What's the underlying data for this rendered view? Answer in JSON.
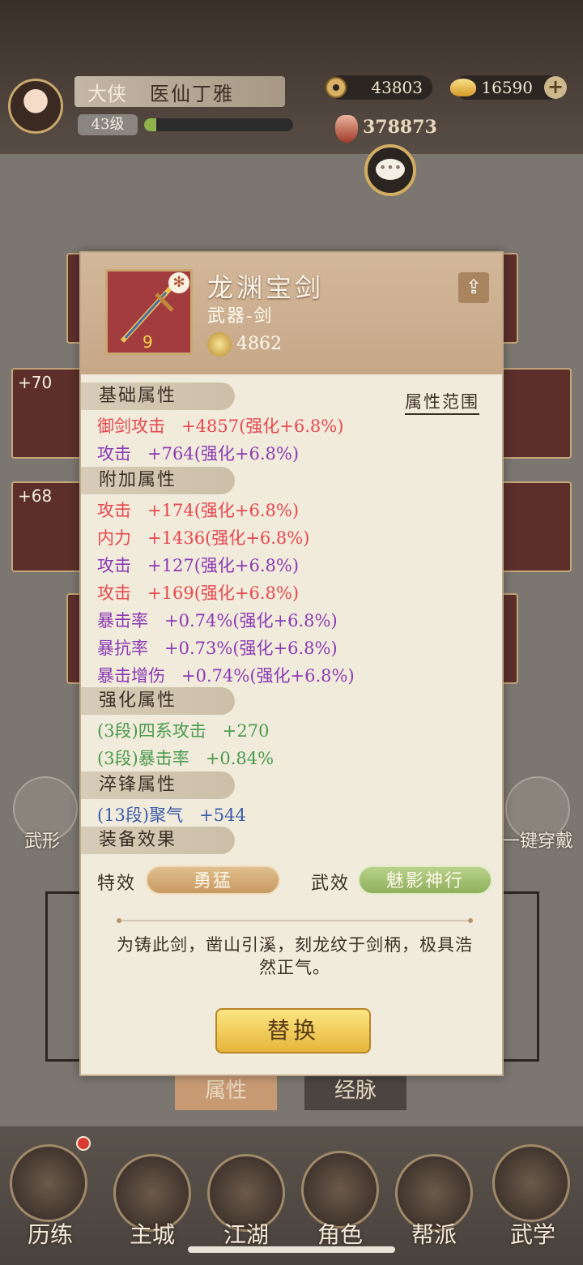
{
  "player": {
    "rank": "大侠",
    "name": "医仙丁雅",
    "level": "43级",
    "exp_progress": 0.08
  },
  "currency": {
    "coins": "43803",
    "gold": "16590",
    "power": "378873"
  },
  "background": {
    "slot_levels": [
      "+70",
      "+68"
    ],
    "side_left_label": "武形",
    "side_right_label": "一键穿戴",
    "tabs": [
      "属性",
      "经脉"
    ],
    "nav": [
      "历练",
      "主城",
      "江湖",
      "角色",
      "帮派",
      "武学"
    ]
  },
  "item": {
    "name": "龙渊宝剑",
    "type": "武器-剑",
    "score": "4862",
    "level_badge": "9"
  },
  "range_button": "属性范围",
  "sections": {
    "base": {
      "title": "基础属性",
      "rows": [
        "御剑攻击   +4857(强化+6.8%)",
        "攻击   +764(强化+6.8%)"
      ]
    },
    "extra": {
      "title": "附加属性",
      "rows": [
        "攻击   +174(强化+6.8%)",
        "内力   +1436(强化+6.8%)",
        "攻击   +127(强化+6.8%)",
        "攻击   +169(强化+6.8%)",
        "暴击率   +0.74%(强化+6.8%)",
        "暴抗率   +0.73%(强化+6.8%)",
        "暴击增伤   +0.74%(强化+6.8%)"
      ]
    },
    "enhance": {
      "title": "强化属性",
      "rows": [
        "(3段)四系攻击   +270",
        "(3段)暴击率   +0.84%"
      ]
    },
    "temper": {
      "title": "淬锋属性",
      "rows": [
        "(13段)聚气   +544"
      ]
    },
    "effect": {
      "title": "装备效果"
    }
  },
  "effects": {
    "special_label": "特效",
    "special_value": "勇猛",
    "martial_label": "武效",
    "martial_value": "魅影神行"
  },
  "description": "为铸此剑，凿山引溪，刻龙纹于剑柄，极具浩然正气。",
  "replace_button": "替换"
}
